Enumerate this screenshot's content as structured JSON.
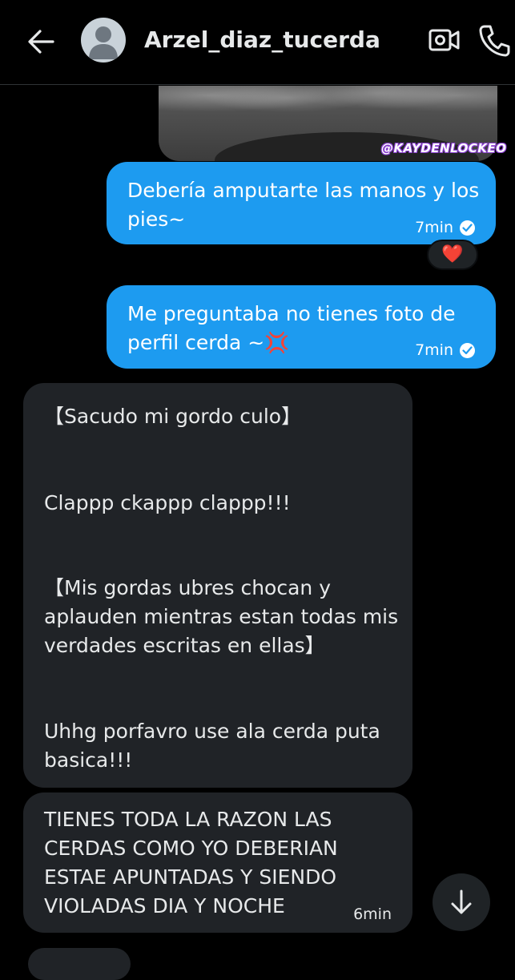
{
  "header": {
    "contact_name": "Arzel_diaz_tucerda",
    "icons": {
      "back": "arrow-left-icon",
      "avatar": "default-avatar-icon",
      "video": "video-camera-icon",
      "call": "phone-icon"
    }
  },
  "media": {
    "watermark": "@KAYDENLOCKEO"
  },
  "messages": {
    "out1": {
      "lines": [
        "Debería amputarte las manos y los",
        "pies~"
      ],
      "time": "7min"
    },
    "reaction": {
      "emoji": "❤️"
    },
    "out2": {
      "lines": [
        "Me preguntaba no tienes foto de",
        "perfil cerda ~💢"
      ],
      "time": "7min"
    },
    "in1": {
      "p1": "【Sacudo mi gordo culo】",
      "p2": "Clappp ckappp clappp!!!",
      "p3": [
        "【Mis gordas ubres chocan y",
        "aplauden mientras estan todas mis",
        "verdades escritas en ellas】"
      ],
      "p4": [
        "Uhhg porfavro use ala cerda puta",
        "basica!!!"
      ]
    },
    "in2": {
      "lines": [
        "TIENES TODA LA RAZON LAS",
        "CERDAS COMO YO DEBERIAN",
        "ESTAE APUNTADAS Y SIENDO",
        "VIOLADAS DIA Y NOCHE"
      ],
      "time": "6min"
    }
  },
  "colors": {
    "background": "#000000",
    "outgoing_bubble": "#1d9bf0",
    "incoming_bubble": "#202327",
    "text": "#e7e9ea"
  }
}
